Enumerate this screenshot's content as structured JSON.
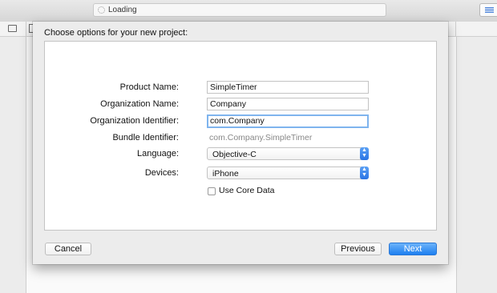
{
  "toolbar": {
    "activity_status": "Loading",
    "right_button_icon": "document-outline-icon"
  },
  "sheet": {
    "title": "Choose options for your new project:",
    "fields": {
      "product_name": {
        "label": "Product Name:",
        "value": "SimpleTimer"
      },
      "organization_name": {
        "label": "Organization Name:",
        "value": "Company"
      },
      "organization_identifier": {
        "label": "Organization Identifier:",
        "value": "com.Company"
      },
      "bundle_identifier": {
        "label": "Bundle Identifier:",
        "value": "com.Company.SimpleTimer"
      },
      "language": {
        "label": "Language:",
        "value": "Objective-C"
      },
      "devices": {
        "label": "Devices:",
        "value": "iPhone"
      },
      "use_core_data": {
        "label": "Use Core Data",
        "checked": false
      }
    },
    "buttons": {
      "cancel": "Cancel",
      "previous": "Previous",
      "next": "Next"
    }
  },
  "colors": {
    "accent": "#2a7ff0",
    "focus_ring": "#7fb4ee"
  }
}
